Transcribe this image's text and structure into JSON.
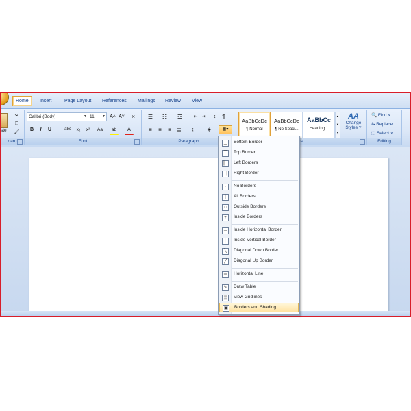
{
  "tabs": [
    "Home",
    "Insert",
    "Page Layout",
    "References",
    "Mailings",
    "Review",
    "View"
  ],
  "groups": {
    "clipboard": "oard",
    "font": "Font",
    "paragraph": "Paragraph",
    "styles": "es",
    "editing": "Editing"
  },
  "font": {
    "family": "Calibri (Body)",
    "size": "11",
    "grow": "A˄",
    "shrink": "A˅",
    "clear": "⨯",
    "bold": "B",
    "italic": "I",
    "underline": "U",
    "strike": "abc",
    "subscript": "x₂",
    "superscript": "x²",
    "case": "Aa",
    "highlight": "ab",
    "color": "A"
  },
  "clipboard": {
    "paste_label": "ste"
  },
  "styles": [
    {
      "sample": "AaBbCcDc",
      "name": "¶ Normal"
    },
    {
      "sample": "AaBbCcDc",
      "name": "¶ No Spaci..."
    },
    {
      "sample": "AaBbCc",
      "name": "Heading 1"
    }
  ],
  "change_styles": {
    "icon": "AA",
    "line1": "Change",
    "line2": "Styles ˅"
  },
  "editing": {
    "find": "Find ˅",
    "replace": "Replace",
    "select": "Select ˅"
  },
  "menu": {
    "items": [
      {
        "label": "Bottom Border",
        "icon": "▁"
      },
      {
        "label": "Top Border",
        "icon": "▔"
      },
      {
        "label": "Left Borders",
        "icon": "▏"
      },
      {
        "label": "Right Border",
        "icon": "▕"
      },
      {
        "label": "No Borders",
        "icon": "·"
      },
      {
        "label": "All Borders",
        "icon": "┼"
      },
      {
        "label": "Outside Borders",
        "icon": "□"
      },
      {
        "label": "Inside Borders",
        "icon": "+"
      },
      {
        "label": "Inside Horizontal Border",
        "icon": "─"
      },
      {
        "label": "Inside Vertical Border",
        "icon": "│"
      },
      {
        "label": "Diagonal Down Border",
        "icon": "╲"
      },
      {
        "label": "Diagonal Up Border",
        "icon": "╱"
      },
      {
        "label": "Horizontal Line",
        "icon": "═"
      },
      {
        "label": "Draw Table",
        "icon": "✎"
      },
      {
        "label": "View Gridlines",
        "icon": "▒"
      },
      {
        "label": "Borders and Shading...",
        "icon": "▣"
      }
    ]
  },
  "colors": {
    "frame": "#d81e2a",
    "highlight": "#ffe3a1",
    "ribbon_text": "#15428b"
  }
}
